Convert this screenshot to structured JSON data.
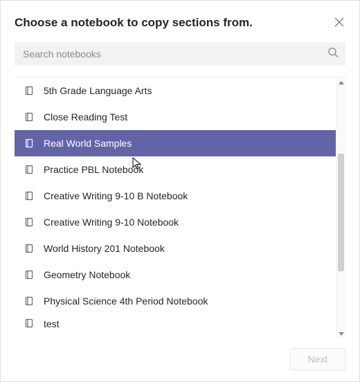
{
  "dialog": {
    "title": "Choose a notebook to copy sections from."
  },
  "search": {
    "placeholder": "Search notebooks"
  },
  "notebooks": {
    "0": {
      "label": "5th Grade Language Arts"
    },
    "1": {
      "label": "Close Reading Test"
    },
    "2": {
      "label": "Real World Samples"
    },
    "3": {
      "label": "Practice PBL Notebook"
    },
    "4": {
      "label": "Creative Writing 9-10 B Notebook"
    },
    "5": {
      "label": "Creative Writing 9-10 Notebook"
    },
    "6": {
      "label": "World History 201 Notebook"
    },
    "7": {
      "label": "Geometry Notebook"
    },
    "8": {
      "label": "Physical Science 4th Period Notebook"
    },
    "9": {
      "label": "test"
    }
  },
  "selected_index": 2,
  "footer": {
    "next_label": "Next"
  },
  "colors": {
    "accent": "#6264a7"
  }
}
